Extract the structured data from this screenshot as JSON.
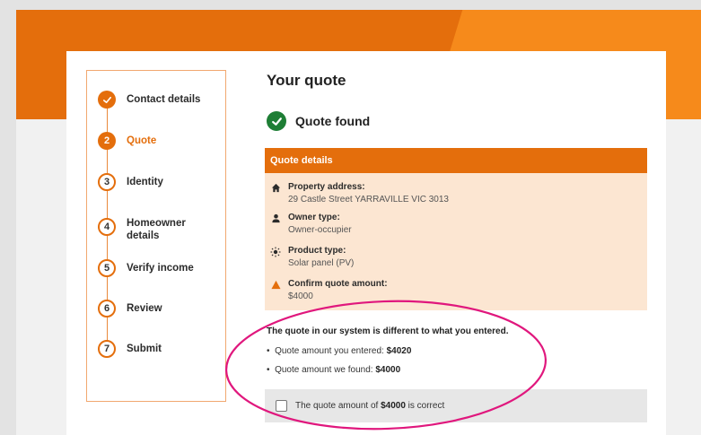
{
  "page": {
    "title": "Your quote"
  },
  "status": {
    "text": "Quote found"
  },
  "steps": [
    {
      "number": "",
      "label": "Contact details",
      "state": "done"
    },
    {
      "number": "2",
      "label": "Quote",
      "state": "active"
    },
    {
      "number": "3",
      "label": "Identity",
      "state": "todo"
    },
    {
      "number": "4",
      "label": "Homeowner details",
      "state": "todo"
    },
    {
      "number": "5",
      "label": "Verify income",
      "state": "todo"
    },
    {
      "number": "6",
      "label": "Review",
      "state": "todo"
    },
    {
      "number": "7",
      "label": "Submit",
      "state": "todo"
    }
  ],
  "quote_details": {
    "header": "Quote details",
    "items": [
      {
        "icon": "home-icon",
        "label": "Property address:",
        "value": "29 Castle Street YARRAVILLE VIC 3013"
      },
      {
        "icon": "person-icon",
        "label": "Owner type:",
        "value": "Owner-occupier"
      },
      {
        "icon": "sun-icon",
        "label": "Product type:",
        "value": "Solar panel (PV)"
      },
      {
        "icon": "warning-icon",
        "label": "Confirm quote amount:",
        "value": "$4000"
      }
    ]
  },
  "discrepancy": {
    "message": "The quote in our system is different to what you entered.",
    "entered_label": "Quote amount you entered: ",
    "entered_value": "$4020",
    "found_label": "Quote amount we found: ",
    "found_value": "$4000"
  },
  "confirm": {
    "prefix": "The quote amount of ",
    "amount": "$4000",
    "suffix": " is correct",
    "checked": false
  },
  "colors": {
    "brand_orange": "#e46e0c",
    "light_orange": "#f68a1b",
    "panel_tint": "#fce6d2",
    "success_green": "#1e7e35",
    "annotation_magenta": "#e0177d"
  }
}
